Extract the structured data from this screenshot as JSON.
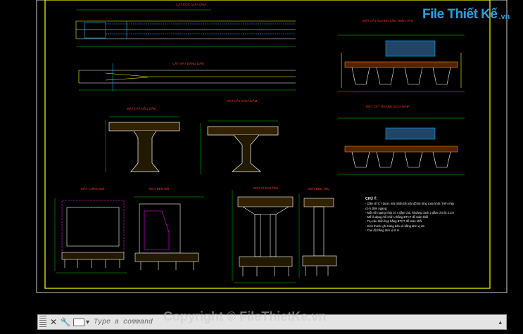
{
  "drawing": {
    "title_top_left": "CẮT DỌC NỬA DẦM",
    "title_top_left_plan": "CẮT MẶT BẰNG DẦM",
    "title_section_end": "MẶT CẮT ĐẦU DẦM",
    "title_section_mid": "MẶT CẮT GIỮA DẦM",
    "title_abutment_front": "MẶT CHÍNH MỐ",
    "title_abutment_side": "MẶT BÊN MỐ",
    "title_pier_front": "MẶT CHÍNH TRỤ",
    "title_pier_side": "MẶT BÊN TRỤ",
    "title_section_right_top": "MẶT CẮT NGANG CẦU TRÊN TRỤ",
    "title_section_right_mid": "MẶT CẮT NGANG GIỮA NHỊP",
    "scale_small": "(1:50)",
    "scale_large": "(1:100)"
  },
  "notes": {
    "title": "CHÚ Ý:",
    "lines": [
      "- Dầm BTCT được mài nhẵn bề mặt đổ bê tông toàn khối. Trên nhịp",
      "  có 5 dầm ngang.",
      "- Mối nối ngang nhịp có 4 dầm chủ, khoảng cách 2 dầm chủ là 2.1m",
      "- Mố là dạng mố chữ U bằng BTCT đổ toàn khối",
      "- Trụ cầu thân hẹp bằng BTCT đổ toàn khối",
      "- Kích thước ghi trong bản vẽ bằng đơn vị cm",
      "- Cao độ bằng đơn vị là m"
    ]
  },
  "watermark": {
    "logo_text": "File Thiết Kế",
    "logo_suffix": ".vn",
    "copyright": "Copyright © FileThietKe.vn"
  },
  "command_line": {
    "placeholder": "Type a command"
  },
  "colors": {
    "frame": "#ffff00",
    "outline": "#ffffff",
    "title": "#ff3030",
    "dimension": "#00ff00",
    "hatch": "#ff8800",
    "blue": "#00b4ff",
    "magenta": "#ff00ff"
  }
}
